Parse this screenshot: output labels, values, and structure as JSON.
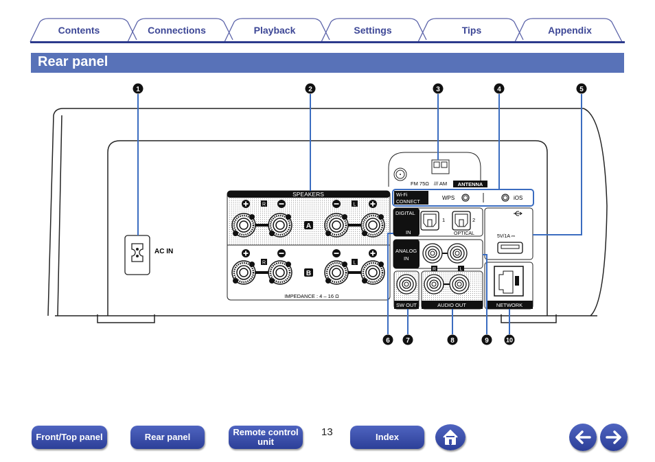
{
  "tabs": [
    "Contents",
    "Connections",
    "Playback",
    "Settings",
    "Tips",
    "Appendix"
  ],
  "section_title": "Rear panel",
  "panel": {
    "ac_in": "AC IN",
    "speakers": "SPEAKERS",
    "speaker_r": "R",
    "speaker_l": "L",
    "zone_a": "A",
    "zone_b": "B",
    "impedance": "IMPEDANCE : 4 – 16 Ω",
    "fm": "FM 75Ω",
    "am": "/// AM",
    "antenna": "ANTENNA",
    "wifi_connect_1": "Wi-Fi",
    "wifi_connect_2": "CONNECT",
    "wps": "WPS",
    "ios": "iOS",
    "digital": "DIGITAL",
    "digital_in": "IN",
    "optical_1": "1",
    "optical_2": "2",
    "optical": "OPTICAL",
    "analog": "ANALOG",
    "analog_in": "IN",
    "usb_rating": "5V/1A ⎓",
    "sw_out": "SW OUT",
    "audio_out": "AUDIO OUT",
    "out_r": "R",
    "out_l": "L",
    "network": "NETWORK"
  },
  "callouts": [
    "1",
    "2",
    "3",
    "4",
    "5",
    "6",
    "7",
    "8",
    "9",
    "10"
  ],
  "callout_color": "#3a6cc0",
  "footer": {
    "front_top_panel": "Front/Top panel",
    "rear_panel": "Rear panel",
    "remote_control_unit": "Remote control unit",
    "page_number": "13",
    "index": "Index",
    "home_icon": "home-icon",
    "back_icon": "arrow-left-icon",
    "forward_icon": "arrow-right-icon"
  }
}
